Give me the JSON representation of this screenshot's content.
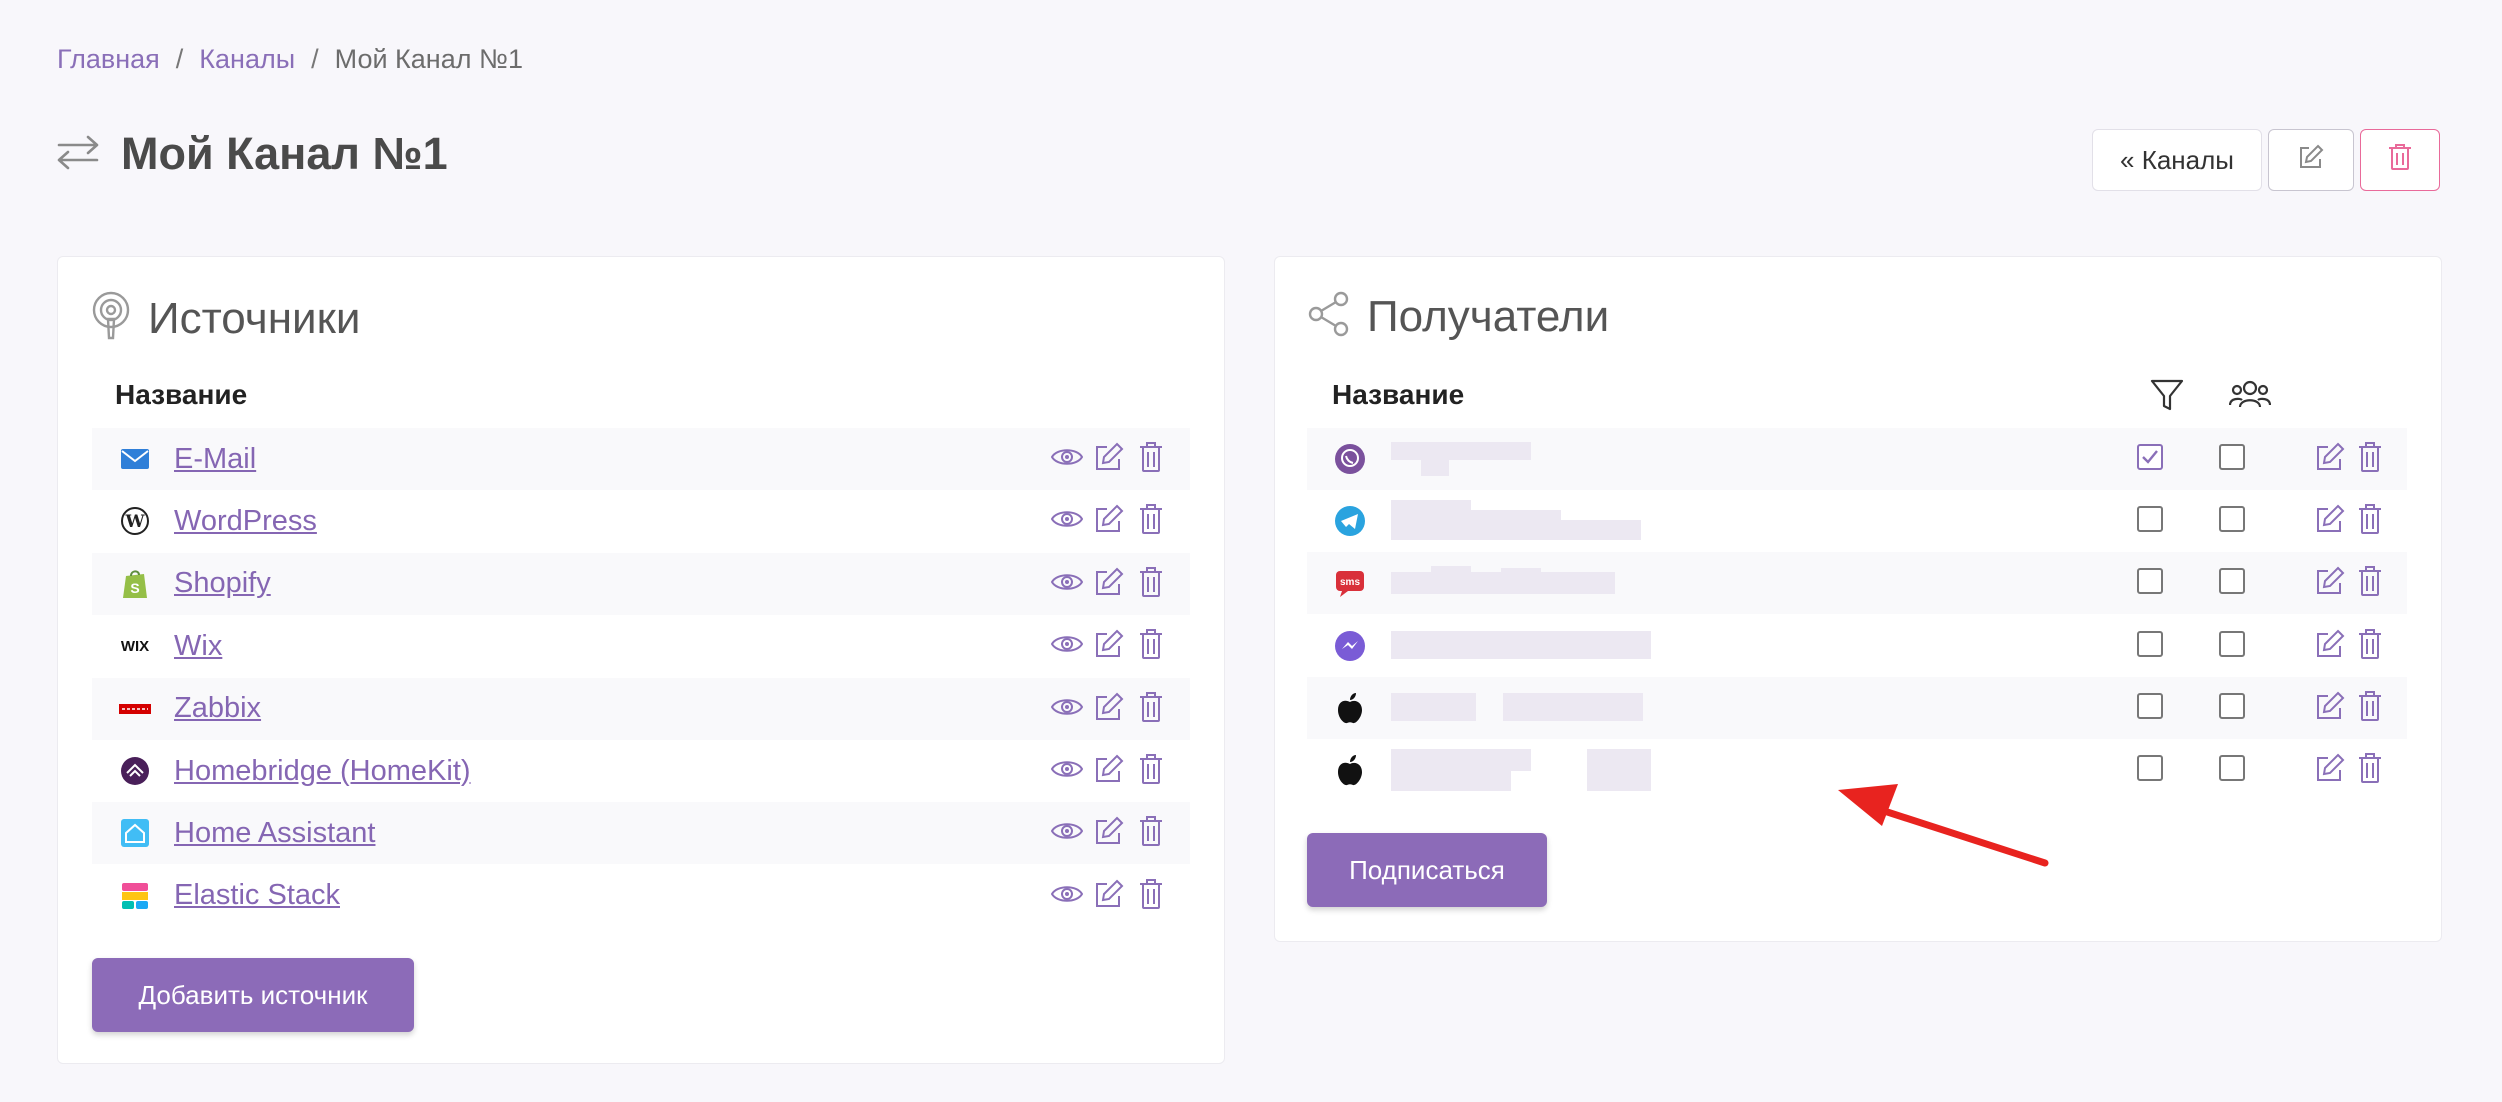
{
  "breadcrumb": {
    "home": "Главная",
    "sep": "/",
    "channels": "Каналы",
    "current": "Мой Канал №1"
  },
  "page": {
    "title": "Мой Канал №1"
  },
  "top_actions": {
    "channels_label": "« Каналы"
  },
  "sources": {
    "title": "Источники",
    "column_name": "Название",
    "items": [
      {
        "label": "E-Mail",
        "icon": "email-icon"
      },
      {
        "label": "WordPress",
        "icon": "wordpress-icon"
      },
      {
        "label": "Shopify",
        "icon": "shopify-icon"
      },
      {
        "label": "Wix",
        "icon": "wix-icon"
      },
      {
        "label": "Zabbix",
        "icon": "zabbix-icon"
      },
      {
        "label": "Homebridge (HomeKit)",
        "icon": "homebridge-icon"
      },
      {
        "label": "Home Assistant",
        "icon": "home-assistant-icon"
      },
      {
        "label": "Elastic Stack",
        "icon": "elastic-stack-icon"
      }
    ],
    "add_button": "Добавить источник"
  },
  "recipients": {
    "title": "Получатели",
    "column_name": "Название",
    "items": [
      {
        "icon": "viber-icon",
        "filter_checked": true,
        "group_checked": false
      },
      {
        "icon": "telegram-icon",
        "filter_checked": false,
        "group_checked": false
      },
      {
        "icon": "sms-icon",
        "filter_checked": false,
        "group_checked": false
      },
      {
        "icon": "messenger-icon",
        "filter_checked": false,
        "group_checked": false
      },
      {
        "icon": "apple-icon",
        "filter_checked": false,
        "group_checked": false
      },
      {
        "icon": "apple-icon",
        "filter_checked": false,
        "group_checked": false
      }
    ],
    "subscribe_button": "Подписаться"
  },
  "colors": {
    "accent": "#8c6bb8",
    "link": "#8566b3",
    "danger": "#e96a9a",
    "annotation_arrow": "#e8231f"
  }
}
